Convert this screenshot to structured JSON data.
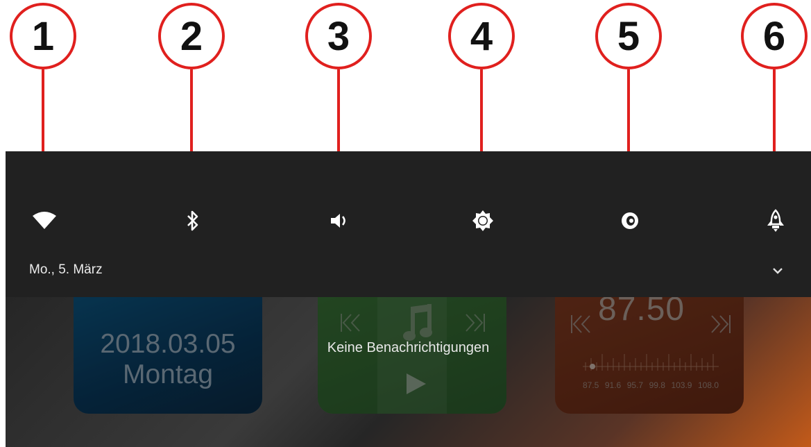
{
  "callouts": [
    "1",
    "2",
    "3",
    "4",
    "5",
    "6"
  ],
  "quick_settings": {
    "icons": [
      "wifi-icon",
      "bluetooth-icon",
      "volume-icon",
      "brightness-icon",
      "speaker-icon",
      "rocket-icon"
    ],
    "date": "Mo., 5. März"
  },
  "notifications": {
    "empty_text": "Keine Benachrichtigungen"
  },
  "widgets": {
    "clock": {
      "date": "2018.03.05",
      "weekday": "Montag"
    },
    "radio": {
      "frequency": "87.50",
      "scale": [
        "87.5",
        "91.6",
        "95.7",
        "99.8",
        "103.9",
        "108.0"
      ]
    }
  },
  "colors": {
    "callout_red": "#e0201e",
    "panel": "#212121"
  }
}
